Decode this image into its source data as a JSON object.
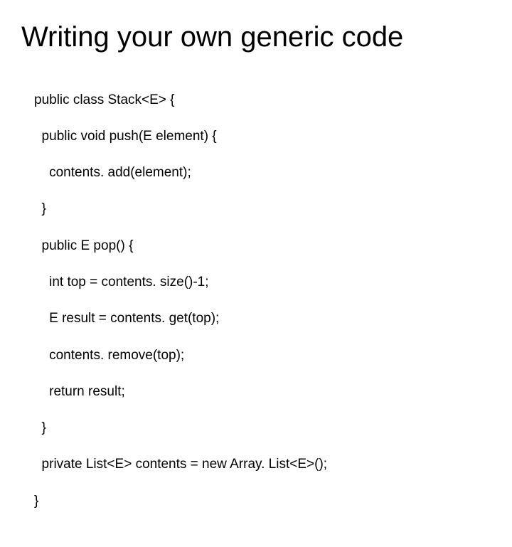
{
  "slide": {
    "title": "Writing your own generic code",
    "code": {
      "l01": "public class Stack<E> {",
      "l02": "  public void push(E element) {",
      "l03": "    contents. add(element);",
      "l04": "  }",
      "l05": "  public E pop() {",
      "l06": "    int top = contents. size()-1;",
      "l07": "    E result = contents. get(top);",
      "l08": "    contents. remove(top);",
      "l09": "    return result;",
      "l10": "  }",
      "l11": "  private List<E> contents = new Array. List<E>();",
      "l12": "}"
    }
  }
}
